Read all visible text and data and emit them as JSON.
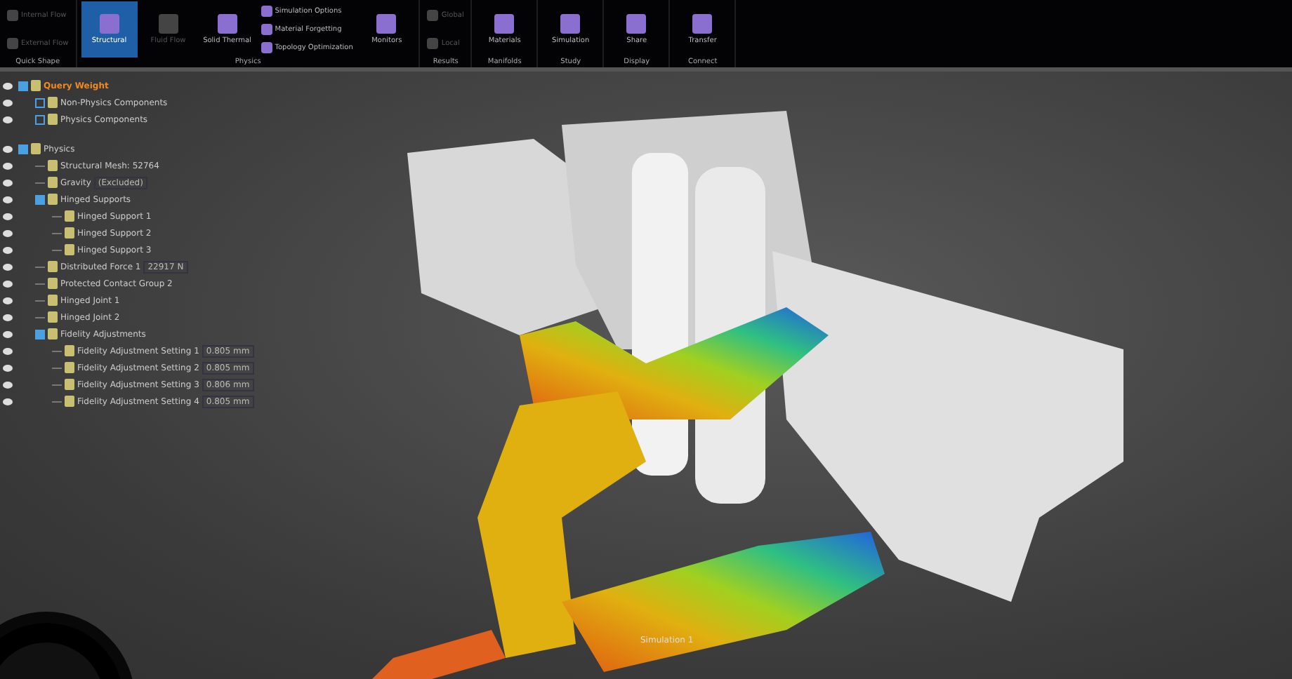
{
  "ribbon": {
    "groups": [
      {
        "label": "Quick Shape",
        "items": [
          {
            "label": "Internal Flow",
            "kind": "small",
            "disabled": true,
            "selected": false
          },
          {
            "label": "External Flow",
            "kind": "small",
            "disabled": true,
            "selected": false
          }
        ]
      },
      {
        "label": "Physics",
        "items": [
          {
            "label": "Structural",
            "kind": "large",
            "disabled": false,
            "selected": true
          },
          {
            "label": "Fluid Flow",
            "kind": "large",
            "disabled": true,
            "selected": false
          },
          {
            "label": "Solid Thermal",
            "kind": "large",
            "disabled": false,
            "selected": false
          },
          {
            "label": "Simulation Options",
            "kind": "small",
            "disabled": false,
            "selected": false
          },
          {
            "label": "Material Forgetting",
            "kind": "small",
            "disabled": false,
            "selected": false
          },
          {
            "label": "Topology Optimization",
            "kind": "small",
            "disabled": false,
            "selected": false
          },
          {
            "label": "Monitors",
            "kind": "large",
            "disabled": false,
            "selected": false
          }
        ]
      },
      {
        "label": "Results",
        "items": [
          {
            "label": "Global",
            "kind": "small",
            "disabled": true,
            "selected": false
          },
          {
            "label": "Local",
            "kind": "small",
            "disabled": true,
            "selected": false
          }
        ]
      },
      {
        "label": "Manifolds",
        "items": [
          {
            "label": "Materials",
            "kind": "large",
            "disabled": false,
            "selected": false
          }
        ]
      },
      {
        "label": "Study",
        "items": [
          {
            "label": "Simulation",
            "kind": "large",
            "disabled": false,
            "selected": false
          }
        ]
      },
      {
        "label": "Display",
        "items": [
          {
            "label": "Share",
            "kind": "large",
            "disabled": false,
            "selected": false
          }
        ]
      },
      {
        "label": "Connect",
        "items": [
          {
            "label": "Transfer",
            "kind": "large",
            "disabled": false,
            "selected": false
          }
        ]
      }
    ]
  },
  "tree": [
    {
      "label": "Query Weight",
      "selected": true,
      "expanded": true,
      "children": [
        {
          "label": "Non-Physics Components",
          "selected": false,
          "expanded": false
        },
        {
          "label": "Physics Components",
          "selected": false,
          "expanded": false
        }
      ]
    },
    {
      "label": "Physics",
      "selected": false,
      "expanded": true,
      "children": [
        {
          "label": "Structural Mesh: 52764",
          "selected": false
        },
        {
          "label": "Gravity",
          "value": "(Excluded)",
          "selected": false
        },
        {
          "label": "Hinged Supports",
          "selected": false,
          "expanded": true,
          "children": [
            {
              "label": "Hinged Support 1",
              "selected": false
            },
            {
              "label": "Hinged Support 2",
              "selected": false
            },
            {
              "label": "Hinged Support 3",
              "selected": false
            }
          ]
        },
        {
          "label": "Distributed Force 1",
          "value": "22917 N",
          "selected": false
        },
        {
          "label": "Protected Contact Group 2",
          "selected": false
        },
        {
          "label": "Hinged Joint 1",
          "selected": false
        },
        {
          "label": "Hinged Joint 2",
          "selected": false
        },
        {
          "label": "Fidelity Adjustments",
          "selected": false,
          "expanded": true,
          "children": [
            {
              "label": "Fidelity Adjustment Setting 1",
              "value": "0.805 mm",
              "selected": false
            },
            {
              "label": "Fidelity Adjustment Setting 2",
              "value": "0.805 mm",
              "selected": false
            },
            {
              "label": "Fidelity Adjustment Setting 3",
              "value": "0.806 mm",
              "selected": false
            },
            {
              "label": "Fidelity Adjustment Setting 4",
              "value": "0.805 mm",
              "selected": false
            }
          ]
        }
      ]
    }
  ],
  "viewport": {
    "study_label": "Simulation 1"
  }
}
